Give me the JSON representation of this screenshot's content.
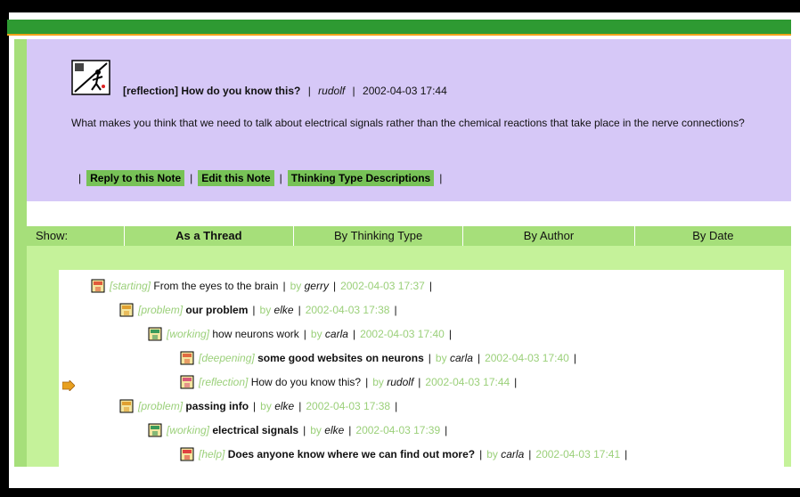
{
  "note": {
    "type": "[reflection]",
    "title": "How do you know this?",
    "author": "rudolf",
    "date": "2002-04-03 17:44",
    "body": "What makes you think that we need to talk about electrical signals rather than the chemical reactions that take place in the nerve connections?",
    "icon": "reflection-person-icon"
  },
  "actions": {
    "reply": "Reply to this Note",
    "edit": "Edit this Note",
    "descriptions": "Thinking Type Descriptions"
  },
  "show_bar": {
    "label": "Show:",
    "tabs": [
      "As a Thread",
      "By Thinking Type",
      "By Author",
      "By Date"
    ]
  },
  "thread": [
    {
      "type": "[starting]",
      "title": "From the eyes to the brain",
      "by": "by",
      "author": "gerry",
      "date": "2002-04-03 17:37",
      "bold": false
    },
    {
      "type": "[problem]",
      "title": "our problem",
      "by": "by",
      "author": "elke",
      "date": "2002-04-03 17:38",
      "bold": true
    },
    {
      "type": "[working]",
      "title": "how neurons work",
      "by": "by",
      "author": "carla",
      "date": "2002-04-03 17:40",
      "bold": false
    },
    {
      "type": "[deepening]",
      "title": "some good websites on neurons",
      "by": "by",
      "author": "carla",
      "date": "2002-04-03 17:40",
      "bold": true
    },
    {
      "type": "[reflection]",
      "title": "How do you know this?",
      "by": "by",
      "author": "rudolf",
      "date": "2002-04-03 17:44",
      "bold": false
    },
    {
      "type": "[problem]",
      "title": "passing info",
      "by": "by",
      "author": "elke",
      "date": "2002-04-03 17:38",
      "bold": true
    },
    {
      "type": "[working]",
      "title": "electrical signals",
      "by": "by",
      "author": "elke",
      "date": "2002-04-03 17:39",
      "bold": true
    },
    {
      "type": "[help]",
      "title": "Does anyone know where we can find out more?",
      "by": "by",
      "author": "carla",
      "date": "2002-04-03 17:41",
      "bold": true
    }
  ],
  "colors": {
    "header_green": "#2e9a32",
    "note_bg": "#d6c8f7",
    "tab_green": "#a6df7a",
    "list_green": "#c5f29a",
    "button_green": "#77c257",
    "meta_green": "#9bd07a"
  }
}
